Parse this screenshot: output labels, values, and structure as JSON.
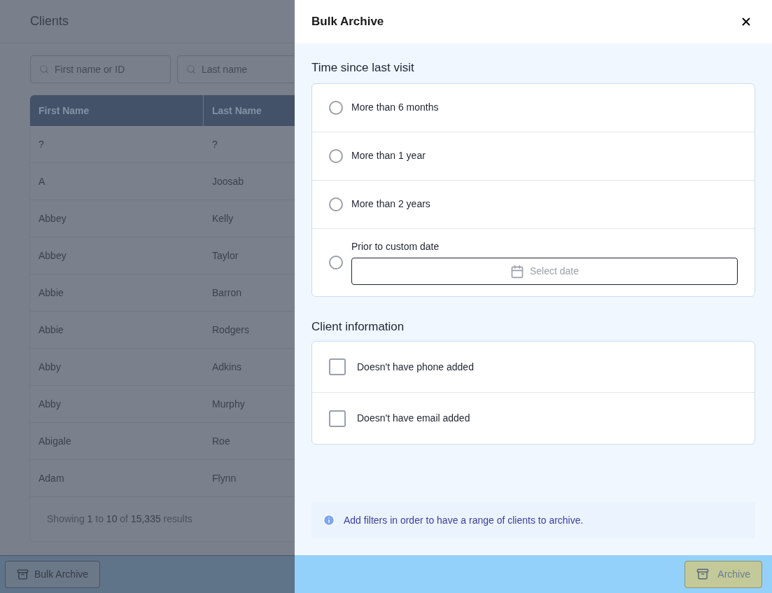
{
  "page": {
    "title": "Clients",
    "search_fields": [
      {
        "placeholder": "First name or ID"
      },
      {
        "placeholder": "Last name"
      }
    ],
    "table": {
      "columns": [
        "First Name",
        "Last Name"
      ],
      "rows": [
        [
          "?",
          "?"
        ],
        [
          "A",
          "Joosab"
        ],
        [
          "Abbey",
          "Kelly"
        ],
        [
          "Abbey",
          "Taylor"
        ],
        [
          "Abbie",
          "Barron"
        ],
        [
          "Abbie",
          "Rodgers"
        ],
        [
          "Abby",
          "Adkins"
        ],
        [
          "Abby",
          "Murphy"
        ],
        [
          "Abigale",
          "Roe"
        ],
        [
          "Adam",
          "Flynn"
        ]
      ],
      "summary": "Showing **1** to **10** of **15,335** results"
    },
    "bulk_button": "Bulk Archive"
  },
  "dialog": {
    "title": "Bulk Archive",
    "time_section": {
      "heading": "Time since last visit",
      "options": [
        {
          "kind": "radio",
          "label": "More than 6 months",
          "selected": false
        },
        {
          "kind": "radio",
          "label": "More than 1 year",
          "selected": false
        },
        {
          "kind": "radio",
          "label": "More than 2 years",
          "selected": false
        },
        {
          "kind": "date",
          "label": "Prior to custom date",
          "selected": false,
          "placeholder": "Select date"
        }
      ]
    },
    "info_section": {
      "heading": "Client information",
      "options": [
        {
          "label": "Doesn't have phone added",
          "checked": false
        },
        {
          "label": "Doesn't have email added",
          "checked": false
        }
      ]
    },
    "notice": "Add filters in order to have a range of clients to archive.",
    "archive_button": {
      "label": "Archive",
      "disabled": true
    }
  }
}
